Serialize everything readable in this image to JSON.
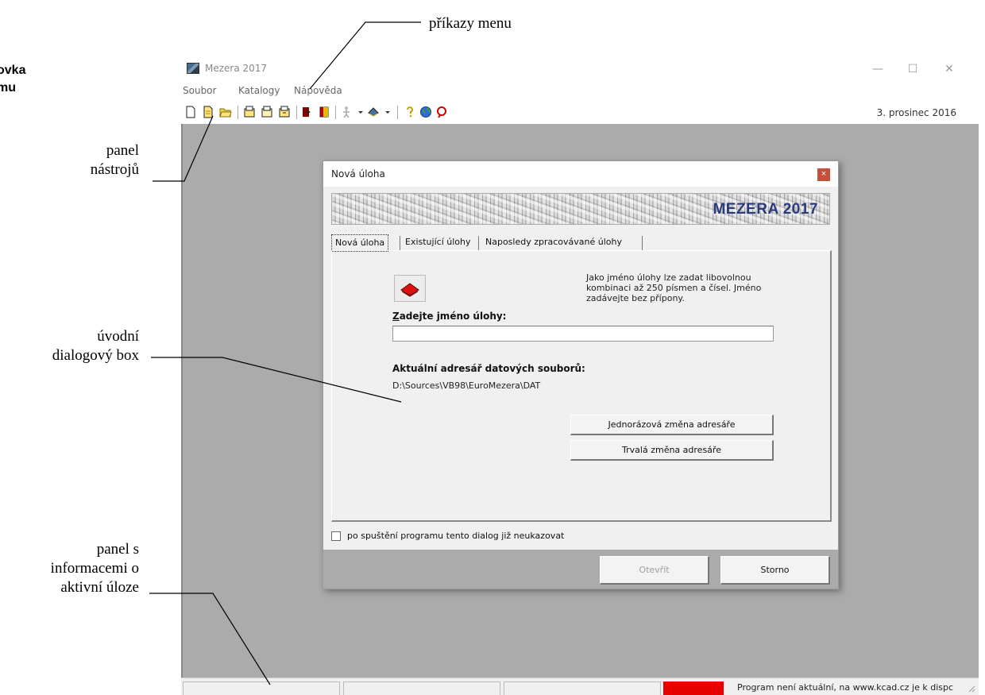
{
  "annotations": {
    "menu_commands": "příkazy menu",
    "title_bar_partial_line1": "ovka",
    "title_bar_partial_line2": "mu",
    "toolbar_line1": "panel",
    "toolbar_line2": "nástrojů",
    "intro_dialog_line1": "úvodní",
    "intro_dialog_line2": "dialogový box",
    "status_panel_line1": "panel s",
    "status_panel_line2": "informacemi o",
    "status_panel_line3": "aktivní úloze"
  },
  "window": {
    "title": "Mezera 2017",
    "controls": {
      "minimize": "—",
      "maximize": "☐",
      "close": "✕"
    }
  },
  "menu": {
    "items": [
      "Soubor",
      "Katalogy",
      "Nápověda"
    ]
  },
  "toolbar": {
    "icons": [
      "new-file-icon",
      "new-document-icon",
      "open-folder-icon",
      "properties-1-icon",
      "properties-2-icon",
      "properties-3-icon",
      "import-icon",
      "book-icon",
      "figure-icon",
      "dropdown-arrow-icon",
      "measure-icon",
      "dropdown-arrow-icon",
      "help-icon",
      "globe-icon",
      "search-icon"
    ],
    "date": "3. prosinec 2016"
  },
  "status_bar": {
    "indicator_color": "#e60000",
    "message": "Program není aktuální, na www.kcad.cz je k dispc"
  },
  "dialog": {
    "title": "Nová úloha",
    "close": "×",
    "banner": "MEZERA 2017",
    "tabs": [
      "Nová úloha",
      "Existující úlohy",
      "Naposledy zpracovávané úlohy"
    ],
    "active_tab": "Nová úloha",
    "hint": "Jako jméno úlohy lze zadat libovolnou kombinaci až 250 písmen a čísel. Jméno zadávejte bez přípony.",
    "name_label_prefix": "Z",
    "name_label_rest": "adejte jméno úlohy:",
    "name_value": "",
    "data_dir_label": "Aktuální adresář datových souborů:",
    "data_dir_path": "D:\\Sources\\VB98\\EuroMezera\\DAT",
    "btn_once": "Jednorázová změna adresáře",
    "btn_permanent": "Trvalá změna adresáře",
    "checkbox_label": "po spuštění programu tento dialog již neukazovat",
    "checkbox_checked": false,
    "btn_open": "Otevřít",
    "btn_cancel": "Storno"
  }
}
